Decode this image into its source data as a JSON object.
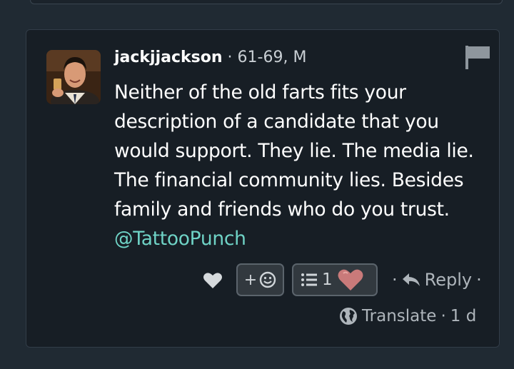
{
  "post": {
    "username": "jackjjackson",
    "separator": "·",
    "age_range": "61-69, M",
    "body_text": "Neither of the old farts fits your description of a candidate that you would support. They lie. The media lie. The financial community lies. Besides family and friends who do you trust. ",
    "mention": "@TattooPunch"
  },
  "actions": {
    "react_plus": "+",
    "thread_count": "1",
    "reply_prefix": "·",
    "reply_label": "Reply",
    "reply_suffix": "·",
    "translate_label": "Translate",
    "time_separator": "·",
    "age": "1 d"
  },
  "icons": {
    "avatar": "avatar-man-toasting",
    "flag": "flag-icon",
    "heart": "heart-icon",
    "emoji": "smiley-icon",
    "list": "list-icon",
    "reaction": "heart-reaction-icon",
    "reply": "reply-arrow-icon",
    "globe": "globe-icon"
  },
  "colors": {
    "background": "#202a33",
    "card": "#171e25",
    "mention": "#6fd3c6",
    "muted": "#aeb5bb",
    "heart_reaction": "#c97a7a"
  }
}
